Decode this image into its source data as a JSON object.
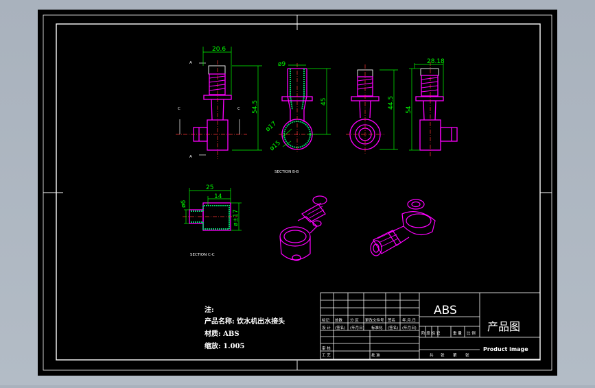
{
  "drawing": {
    "dims": {
      "front_width": "20.6",
      "front_height": "54.5",
      "bore_dia": "ø9",
      "section_len": "45",
      "ring_outer": "ø17",
      "ring_inner": "ø15",
      "side_height": "44.5",
      "right_width": "28.18",
      "right_height": "54",
      "sec2_len": "25",
      "sec2_inner_len": "14",
      "sec2_small_dia": "ø6",
      "sec2_big_dia": "ø±17"
    },
    "markers": {
      "a_top": "A",
      "a_bottom": "A",
      "c_left": "C",
      "c_right": "C"
    },
    "section_labels": {
      "section_bb": "SECTION    B-B",
      "section_cc": "SECTION    C-C"
    }
  },
  "notes": {
    "heading": "注:",
    "product_name": "产品名称: 饮水机出水接头",
    "material": "材质: ABS",
    "scale": "缩放: 1.005"
  },
  "title_block": {
    "material": "ABS",
    "title": "产品图",
    "subtitle": "Product image",
    "row_labels": [
      "标记",
      "处数",
      "分 区",
      "更改文件号",
      "签名",
      "年.月.日"
    ],
    "row2_labels": [
      "设 计",
      "(签名)",
      "(年月日)",
      "标准化",
      "(签名)",
      "(年月日)"
    ],
    "stage_labels": [
      "阶 段 标 记",
      "重 量",
      "比 例"
    ],
    "review_labels": [
      "审 核",
      "工 艺",
      "批 准"
    ],
    "sheet_labels": [
      "共",
      "张",
      "第",
      "张"
    ]
  }
}
